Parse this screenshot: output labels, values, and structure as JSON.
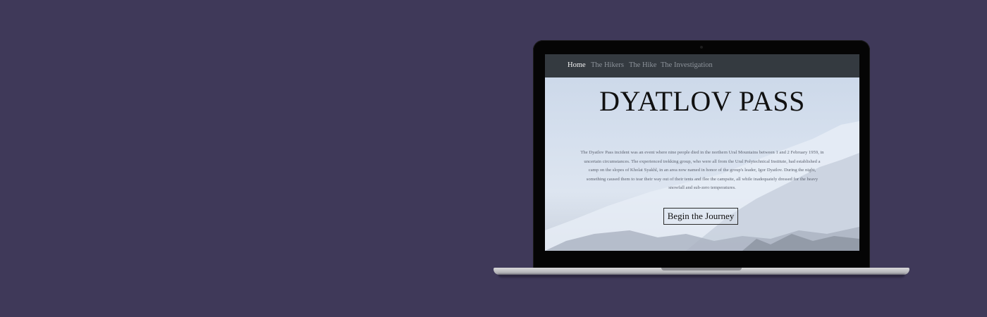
{
  "nav": {
    "items": [
      {
        "label": "Home",
        "active": true
      },
      {
        "label": "The Hikers",
        "active": false
      },
      {
        "label": "The Hike",
        "active": false
      },
      {
        "label": "The Investigation",
        "active": false
      }
    ]
  },
  "hero": {
    "title": "DYATLOV PASS",
    "text": "The Dyatlov Pass incident was an event where nine people died in the northern Ural Mountains between 1 and 2 February 1959, in uncertain circumstances. The experienced trekking group, who were all from the Ural Polytechnical Institute, had established a camp on the slopes of Kholat Syakhl, in an area now named in honor of the group's leader, Igor Dyatlov. During the night, something caused them to tear their way out of their tents and flee the campsite, all while inadequately dressed for the heavy snowfall and sub-zero temperatures.",
    "cta_label": "Begin the Journey"
  },
  "colors": {
    "background": "#3f3959",
    "navbar": "#343a40",
    "nav_active": "#f4f4f4",
    "nav_inactive": "#8d939a"
  }
}
